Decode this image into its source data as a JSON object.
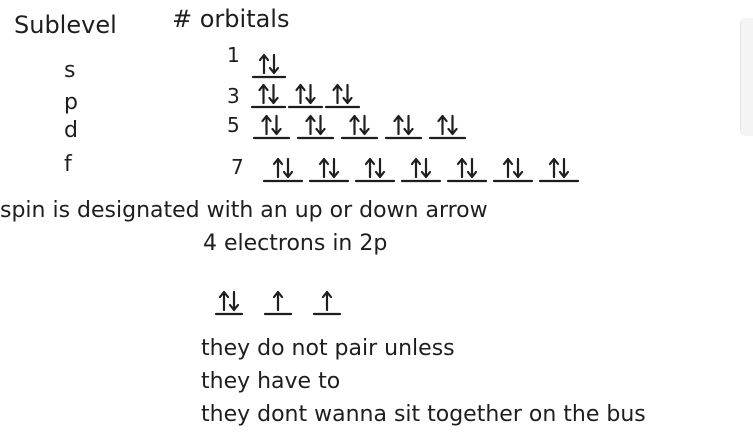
{
  "header": {
    "sublevel": "Sublevel",
    "orbitals": "# orbitals"
  },
  "rows": [
    {
      "sublevel": "s",
      "count": "1",
      "slots": [
        "paired"
      ]
    },
    {
      "sublevel": "p",
      "count": "3",
      "slots": [
        "paired",
        "paired",
        "paired"
      ]
    },
    {
      "sublevel": "d",
      "count": "5",
      "slots": [
        "paired",
        "paired",
        "paired",
        "paired",
        "paired"
      ]
    },
    {
      "sublevel": "f",
      "count": "7",
      "slots": [
        "paired",
        "paired",
        "paired",
        "paired",
        "paired",
        "paired",
        "paired"
      ]
    }
  ],
  "spin_note": "spin is designated with an up or down arrow",
  "example": {
    "label": "4 electrons in 2p",
    "slots": [
      "paired",
      "up",
      "up"
    ]
  },
  "notes": [
    "they do not pair unless",
    "they have to",
    "they dont wanna sit together on the bus"
  ],
  "ink_color": "#1e1e1e"
}
